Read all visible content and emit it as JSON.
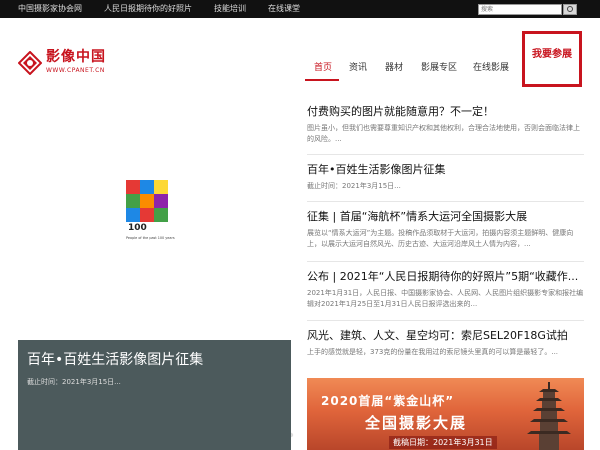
{
  "topbar": {
    "links": [
      "中国摄影家协会网",
      "人民日报期待你的好照片",
      "技能培训",
      "在线课堂"
    ],
    "search_placeholder": "搜索"
  },
  "logo": {
    "name": "影像中国",
    "url": "WWW.CPANET.CN"
  },
  "nav": {
    "items": [
      "首页",
      "资讯",
      "器材",
      "影展专区",
      "在线影展"
    ],
    "active": "首页"
  },
  "join_button": "我要参展",
  "slider": {
    "caption_title": "百年•百姓生活影像图片征集",
    "caption_date": "截止时间：2021年3月15日...",
    "poster_caption": "People of the past 100 years",
    "dots": 5,
    "active_dot": 4
  },
  "news": [
    {
      "title": "付费购买的图片就能随意用？不一定！",
      "desc": "图片虽小，但我们也需要尊重知识产权和其他权利，合理合法地使用，否则会面临法律上的风险。..."
    },
    {
      "title": "百年•百姓生活影像图片征集",
      "desc": "截止时间：2021年3月15日..."
    },
    {
      "title": "征集 | 首届“海航杯”情系大运河全国摄影大展",
      "desc": "展览以“情系大运河”为主题。投稿作品须取材于大运河，拍摄内容须主题鲜明、健康向上，以展示大运河自然风光、历史古迹、大运河沿岸风土人情为内容，..."
    },
    {
      "title": "公布 | 2021年“人民日报期待你的好照片”5期“收藏作...",
      "desc": "2021年1月31日，人民日报、中国摄影家协会、人民网、人民图片组织摄影专家和报社编辑对2021年1月25日至1月31日人民日报评选出来的..."
    },
    {
      "title": "风光、建筑、人文、星空均可：索尼SEL20F18G试拍",
      "desc": "上手的感觉就是轻，373克的份量在我用过的索尼镜头里真的可以算是最轻了。..."
    }
  ],
  "banner": {
    "line1": "2020首届“紫金山杯”",
    "line2": "全国摄影大展",
    "line3": "截稿日期：2021年3月31日"
  },
  "colors": {
    "brand_red": "#c8141e",
    "topbar_bg": "#111111",
    "caption_bg": "#4c5a5c"
  }
}
